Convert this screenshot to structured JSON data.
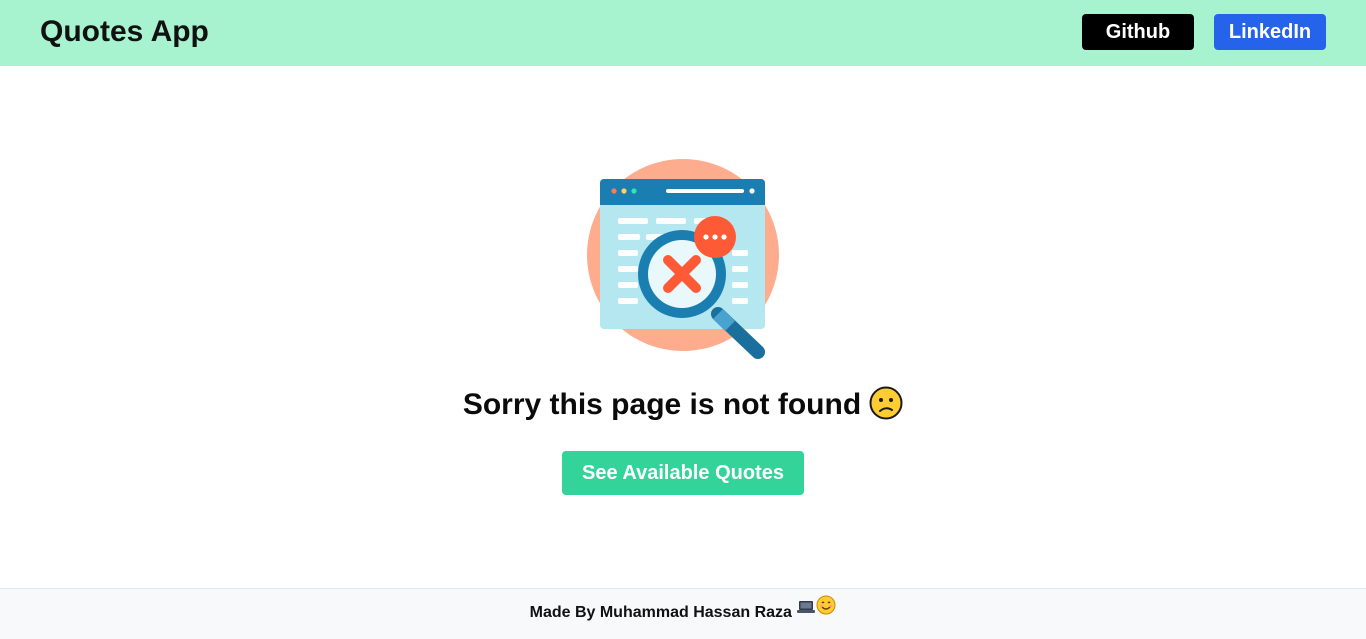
{
  "header": {
    "brand": "Quotes App",
    "links": [
      {
        "label": "Github",
        "color": "#000000"
      },
      {
        "label": "LinkedIn",
        "color": "#2563eb"
      }
    ],
    "background": "#a7f3d0"
  },
  "main": {
    "illustration_icon": "page-not-found-magnifier-icon",
    "message": "Sorry this page is not found",
    "message_emoji_icon": "sad-face-icon",
    "cta_label": "See Available Quotes",
    "cta_color": "#34d399"
  },
  "footer": {
    "text": "Made By Muhammad Hassan Raza",
    "icons": [
      "laptop-icon",
      "smiling-face-icon"
    ]
  }
}
